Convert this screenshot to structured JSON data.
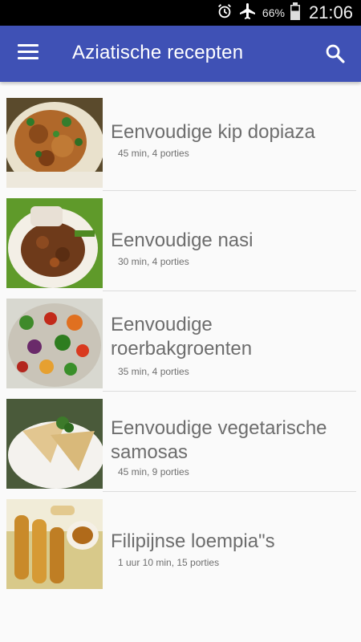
{
  "status": {
    "battery_percent": "66%",
    "time": "21:06",
    "icons": [
      "alarm-icon",
      "airplane-mode-icon",
      "battery-icon"
    ]
  },
  "appbar": {
    "title": "Aziatische recepten",
    "menu_icon": "hamburger-menu-icon",
    "search_icon": "search-icon",
    "color": "#3f51b5"
  },
  "recipes": [
    {
      "title": "Eenvoudige kip dopiaza",
      "meta": "45 min, 4 porties"
    },
    {
      "title": "Eenvoudige nasi",
      "meta": "30 min, 4 porties"
    },
    {
      "title": "Eenvoudige roerbakgroenten",
      "meta": "35 min, 4 porties"
    },
    {
      "title": "Eenvoudige vegetarische samosas",
      "meta": "45 min, 9 porties"
    },
    {
      "title": "Filipijnse loempia\"s",
      "meta": "1 uur 10 min, 15 porties"
    }
  ]
}
